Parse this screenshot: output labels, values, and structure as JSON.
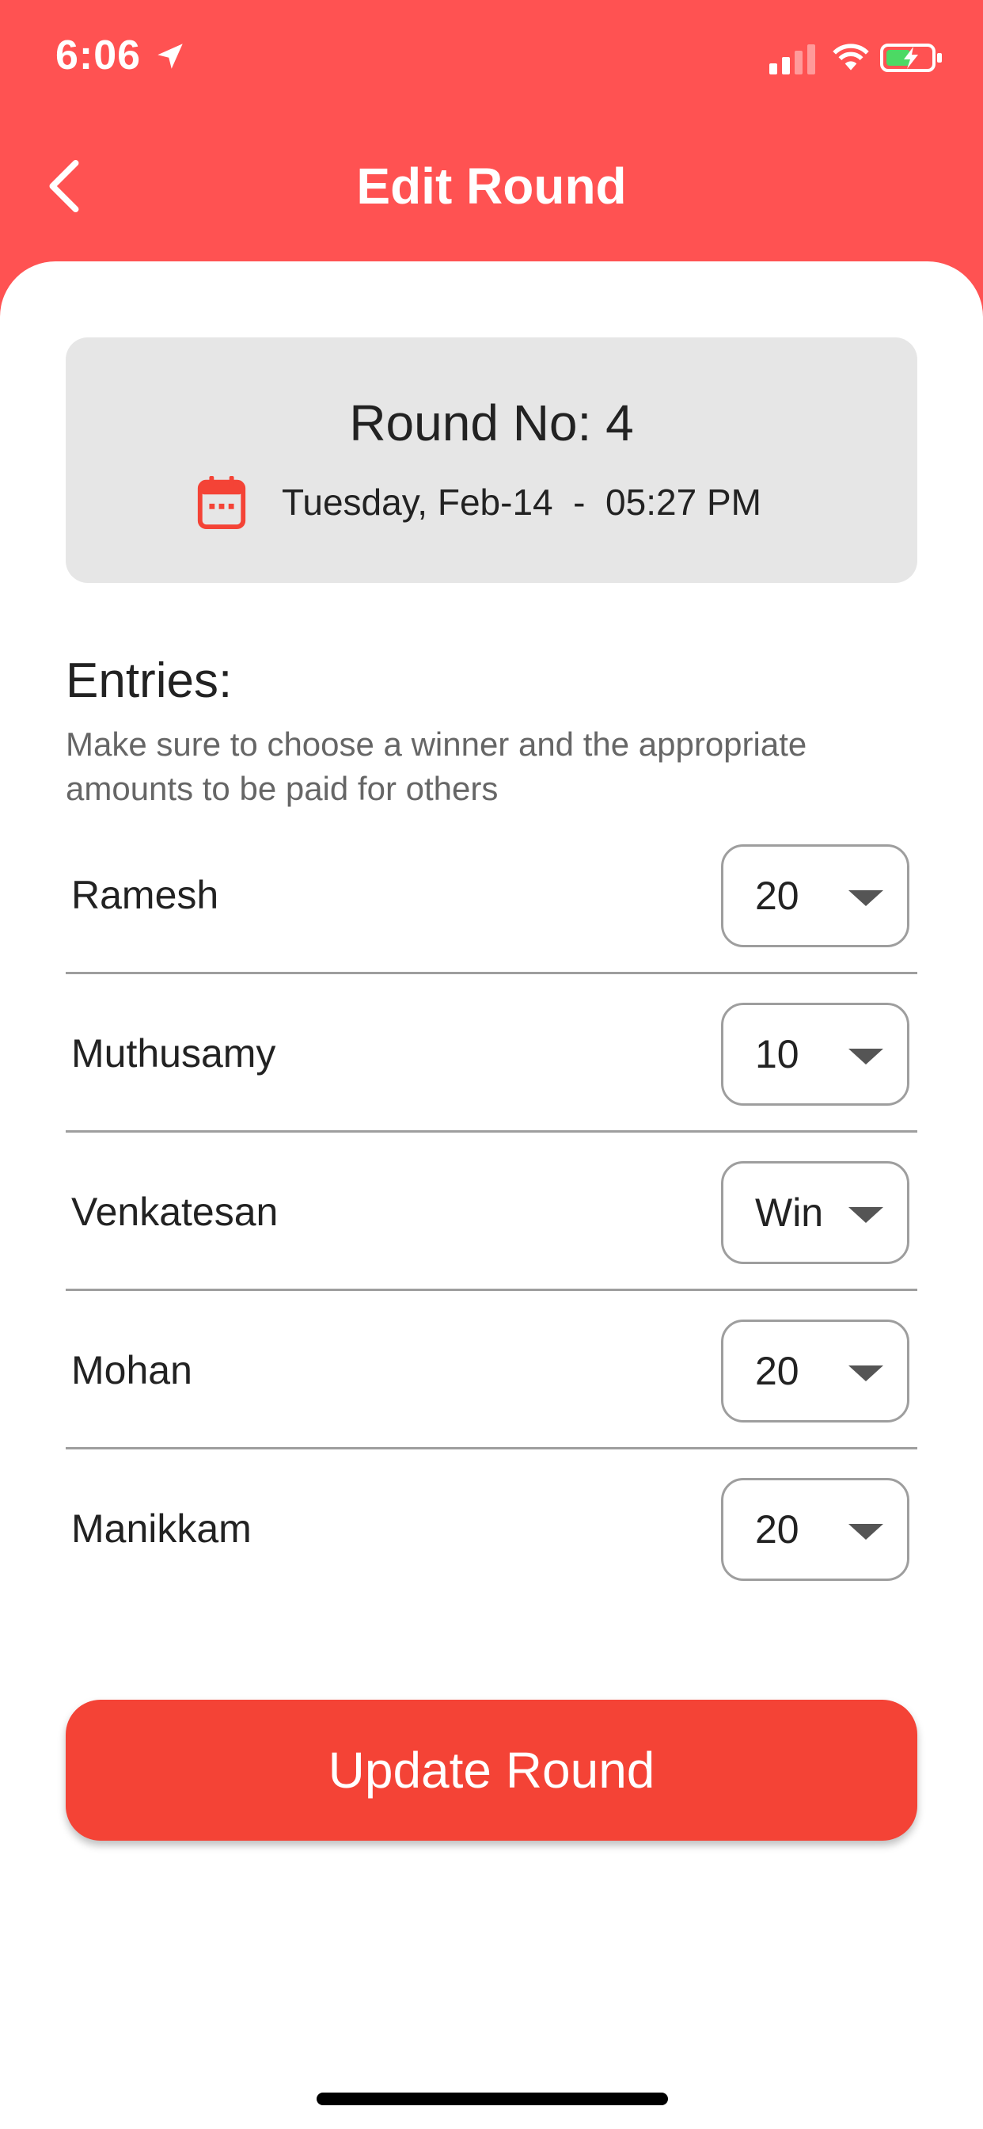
{
  "status_bar": {
    "time": "6:06",
    "icons": [
      "location-arrow-icon",
      "cellular-signal-icon",
      "wifi-icon",
      "battery-charging-icon"
    ]
  },
  "header": {
    "title": "Edit Round",
    "back_icon": "chevron-left-icon",
    "background_color": "#ff5252"
  },
  "round_card": {
    "round_no": "Round No: 4",
    "date_icon": "calendar-icon",
    "date_time": "Tuesday, Feb-14  -  05:27 PM"
  },
  "entries": {
    "title": "Entries:",
    "hint": "Make sure to choose a winner and the appropriate amounts to be paid for others",
    "rows": [
      {
        "name": "Ramesh",
        "amount": "20"
      },
      {
        "name": "Muthusamy",
        "amount": "10"
      },
      {
        "name": "Venkatesan",
        "amount": "Win"
      },
      {
        "name": "Mohan",
        "amount": "20"
      },
      {
        "name": "Manikkam",
        "amount": "20"
      }
    ]
  },
  "actions": {
    "update_label": "Update Round",
    "button_color": "#f44336"
  }
}
